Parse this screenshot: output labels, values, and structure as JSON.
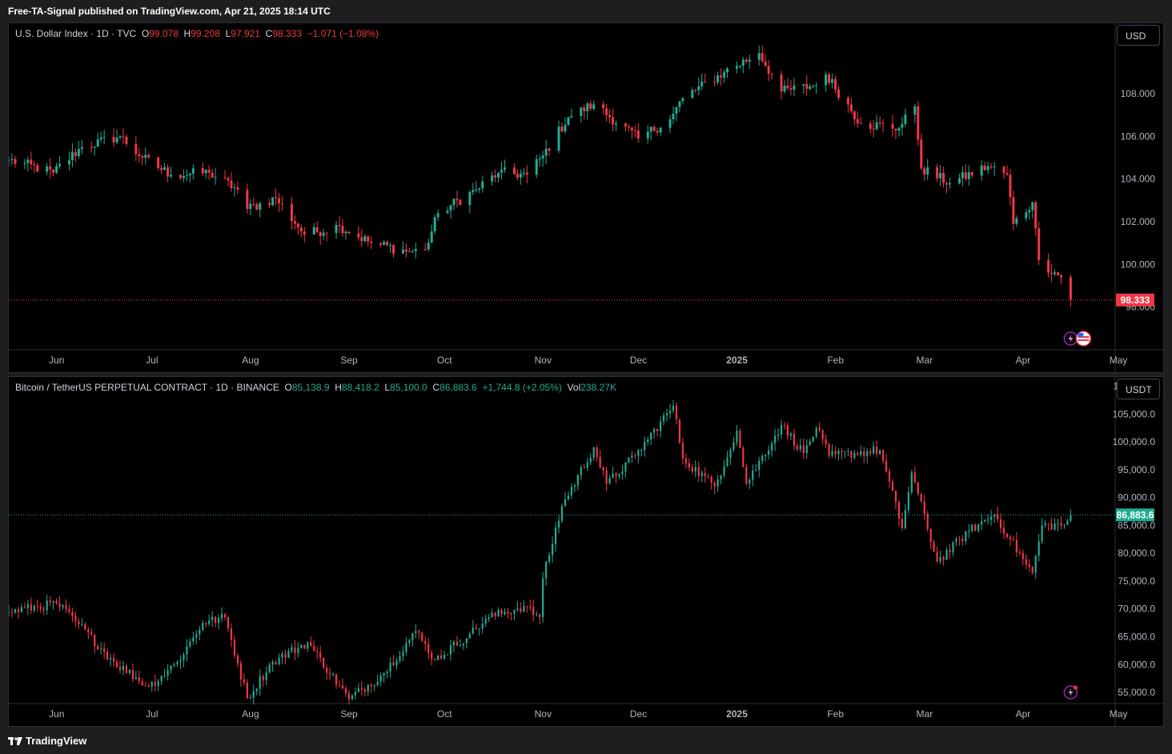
{
  "header": {
    "published": "Free-TA-Signal published on TradingView.com, Apr 21, 2025 18:14 UTC"
  },
  "footer": {
    "brand": "TradingView"
  },
  "colors": {
    "up": "#22ab94",
    "down": "#f23645",
    "background": "#000000",
    "grid_text": "#b2b5be"
  },
  "chart_data": [
    {
      "type": "candlestick",
      "symbol": "U.S. Dollar Index · 1D · TVC",
      "ohlc_labels": {
        "o_label": "O",
        "o": "99.078",
        "h_label": "H",
        "h": "99.208",
        "l_label": "L",
        "l": "97.921",
        "c_label": "C",
        "c": "98.333",
        "change": "−1.071 (−1.08%)"
      },
      "currency": "USD",
      "last_price_label": "98.333",
      "last_price": 98.333,
      "y_range": [
        96.0,
        111.0
      ],
      "y_ticks": [
        {
          "v": 108,
          "label": "108.000"
        },
        {
          "v": 106,
          "label": "106.000"
        },
        {
          "v": 104,
          "label": "104.000"
        },
        {
          "v": 102,
          "label": "102.000"
        },
        {
          "v": 100,
          "label": "100.000"
        },
        {
          "v": 98,
          "label": "98.000"
        }
      ],
      "x_range": [
        "2024-05-22",
        "2025-05-05"
      ],
      "x_ticks": [
        {
          "d": "2024-06-01",
          "label": "Jun"
        },
        {
          "d": "2024-07-01",
          "label": "Jul"
        },
        {
          "d": "2024-08-01",
          "label": "Aug"
        },
        {
          "d": "2024-09-01",
          "label": "Sep"
        },
        {
          "d": "2024-10-01",
          "label": "Oct"
        },
        {
          "d": "2024-11-01",
          "label": "Nov"
        },
        {
          "d": "2024-12-01",
          "label": "Dec"
        },
        {
          "d": "2025-01-01",
          "label": "2025"
        },
        {
          "d": "2025-02-01",
          "label": "Feb"
        },
        {
          "d": "2025-03-01",
          "label": "Mar"
        },
        {
          "d": "2025-04-01",
          "label": "Apr"
        },
        {
          "d": "2025-05-01",
          "label": "May"
        }
      ],
      "series_close": [
        [
          "2024-05-22",
          104.9
        ],
        [
          "2024-06-05",
          104.3
        ],
        [
          "2024-06-14",
          105.5
        ],
        [
          "2024-06-26",
          106.0
        ],
        [
          "2024-07-03",
          105.0
        ],
        [
          "2024-07-12",
          104.2
        ],
        [
          "2024-07-24",
          104.3
        ],
        [
          "2024-08-02",
          103.5
        ],
        [
          "2024-08-05",
          102.6
        ],
        [
          "2024-08-14",
          103.1
        ],
        [
          "2024-08-23",
          101.4
        ],
        [
          "2024-09-03",
          101.8
        ],
        [
          "2024-09-13",
          101.0
        ],
        [
          "2024-09-25",
          100.6
        ],
        [
          "2024-09-30",
          100.7
        ],
        [
          "2024-10-04",
          102.4
        ],
        [
          "2024-10-16",
          103.5
        ],
        [
          "2024-10-23",
          104.3
        ],
        [
          "2024-11-01",
          104.2
        ],
        [
          "2024-11-06",
          105.1
        ],
        [
          "2024-11-14",
          106.9
        ],
        [
          "2024-11-22",
          107.5
        ],
        [
          "2024-12-06",
          105.9
        ],
        [
          "2024-12-16",
          106.8
        ],
        [
          "2024-12-20",
          107.8
        ],
        [
          "2025-01-02",
          109.0
        ],
        [
          "2025-01-13",
          109.9
        ],
        [
          "2025-01-20",
          108.1
        ],
        [
          "2025-01-31",
          108.4
        ],
        [
          "2025-02-03",
          108.9
        ],
        [
          "2025-02-14",
          106.6
        ],
        [
          "2025-02-26",
          106.4
        ],
        [
          "2025-03-03",
          107.4
        ],
        [
          "2025-03-05",
          104.5
        ],
        [
          "2025-03-14",
          103.8
        ],
        [
          "2025-03-26",
          104.6
        ],
        [
          "2025-04-01",
          104.2
        ],
        [
          "2025-04-03",
          101.9
        ],
        [
          "2025-04-09",
          102.9
        ],
        [
          "2025-04-11",
          100.2
        ],
        [
          "2025-04-18",
          99.4
        ],
        [
          "2025-04-21",
          98.333
        ]
      ]
    },
    {
      "type": "candlestick",
      "symbol": "Bitcoin / TetherUS PERPETUAL CONTRACT · 1D · BINANCE",
      "ohlc_labels": {
        "o_label": "O",
        "o": "85,138.9",
        "h_label": "H",
        "h": "88,418.2",
        "l_label": "L",
        "l": "85,100.0",
        "c_label": "C",
        "c": "86,883.6",
        "change": "+1,744.8 (+2.05%)",
        "vol_label": "Vol",
        "vol": "238.27K"
      },
      "currency": "USDT",
      "last_price_label": "86,883.6",
      "last_price": 86883.6,
      "y_range": [
        53000,
        110500
      ],
      "y_ticks": [
        {
          "v": 110000,
          "label": "110,000.0"
        },
        {
          "v": 105000,
          "label": "105,000.0"
        },
        {
          "v": 100000,
          "label": "100,000.0"
        },
        {
          "v": 95000,
          "label": "95,000.0"
        },
        {
          "v": 90000,
          "label": "90,000.0"
        },
        {
          "v": 85000,
          "label": "85,000.0"
        },
        {
          "v": 80000,
          "label": "80,000.0"
        },
        {
          "v": 75000,
          "label": "75,000.0"
        },
        {
          "v": 70000,
          "label": "70,000.0"
        },
        {
          "v": 65000,
          "label": "65,000.0"
        },
        {
          "v": 60000,
          "label": "60,000.0"
        },
        {
          "v": 55000,
          "label": "55,000.0"
        }
      ],
      "x_range": [
        "2024-05-22",
        "2025-05-05"
      ],
      "x_ticks": [
        {
          "d": "2024-06-01",
          "label": "Jun"
        },
        {
          "d": "2024-07-01",
          "label": "Jul"
        },
        {
          "d": "2024-08-01",
          "label": "Aug"
        },
        {
          "d": "2024-09-01",
          "label": "Sep"
        },
        {
          "d": "2024-10-01",
          "label": "Oct"
        },
        {
          "d": "2024-11-01",
          "label": "Nov"
        },
        {
          "d": "2024-12-01",
          "label": "Dec"
        },
        {
          "d": "2025-01-01",
          "label": "2025"
        },
        {
          "d": "2025-02-01",
          "label": "Feb"
        },
        {
          "d": "2025-03-01",
          "label": "Mar"
        },
        {
          "d": "2025-04-01",
          "label": "Apr"
        },
        {
          "d": "2025-05-01",
          "label": "May"
        }
      ],
      "series_close": [
        [
          "2024-05-22",
          69500
        ],
        [
          "2024-06-06",
          71000
        ],
        [
          "2024-06-12",
          67800
        ],
        [
          "2024-06-24",
          60500
        ],
        [
          "2024-07-05",
          56000
        ],
        [
          "2024-07-14",
          60500
        ],
        [
          "2024-07-22",
          67500
        ],
        [
          "2024-07-29",
          68500
        ],
        [
          "2024-08-05",
          54000
        ],
        [
          "2024-08-13",
          60500
        ],
        [
          "2024-08-24",
          64000
        ],
        [
          "2024-09-06",
          53800
        ],
        [
          "2024-09-17",
          58500
        ],
        [
          "2024-09-27",
          66000
        ],
        [
          "2024-10-03",
          60800
        ],
        [
          "2024-10-14",
          65500
        ],
        [
          "2024-10-20",
          68500
        ],
        [
          "2024-10-31",
          70500
        ],
        [
          "2024-11-05",
          68500
        ],
        [
          "2024-11-06",
          75500
        ],
        [
          "2024-11-12",
          88500
        ],
        [
          "2024-11-22",
          99000
        ],
        [
          "2024-11-26",
          92500
        ],
        [
          "2024-12-05",
          97500
        ],
        [
          "2024-12-17",
          106500
        ],
        [
          "2024-12-20",
          97000
        ],
        [
          "2024-12-30",
          92000
        ],
        [
          "2025-01-06",
          102000
        ],
        [
          "2025-01-09",
          92500
        ],
        [
          "2025-01-20",
          103000
        ],
        [
          "2025-01-27",
          98000
        ],
        [
          "2025-01-31",
          102500
        ],
        [
          "2025-02-04",
          97500
        ],
        [
          "2025-02-20",
          98500
        ],
        [
          "2025-02-27",
          84500
        ],
        [
          "2025-03-02",
          94500
        ],
        [
          "2025-03-10",
          78500
        ],
        [
          "2025-03-20",
          84000
        ],
        [
          "2025-03-28",
          87000
        ],
        [
          "2025-04-02",
          82500
        ],
        [
          "2025-04-07",
          78000
        ],
        [
          "2025-04-09",
          76500
        ],
        [
          "2025-04-12",
          85000
        ],
        [
          "2025-04-19",
          85100
        ],
        [
          "2025-04-21",
          86883.6
        ]
      ]
    }
  ]
}
